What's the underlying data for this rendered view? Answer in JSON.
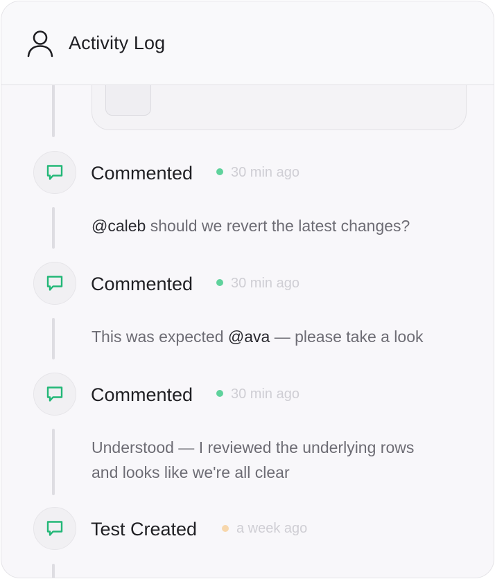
{
  "header": {
    "title": "Activity Log",
    "icon": "user-icon"
  },
  "colors": {
    "comment_icon": "#22b777",
    "dot_recent": "#5fd29c",
    "dot_old": "#f7d7ac"
  },
  "events": [
    {
      "type": "Commented",
      "time": "30 min ago",
      "icon": "comment-icon",
      "comment": {
        "mention": "@caleb",
        "text": " should we revert the latest changes?"
      }
    },
    {
      "type": "Commented",
      "time": "30 min ago",
      "icon": "comment-icon",
      "comment": {
        "before": "This was expected ",
        "mention": "@ava",
        "after": " — please take a look"
      }
    },
    {
      "type": "Commented",
      "time": "30 min ago",
      "icon": "comment-icon",
      "comment": {
        "line1": "Understood — I reviewed the underlying rows",
        "line2": "and looks like we're all clear"
      }
    },
    {
      "type": "Test Created",
      "time": "a week ago",
      "icon": "comment-icon"
    }
  ]
}
